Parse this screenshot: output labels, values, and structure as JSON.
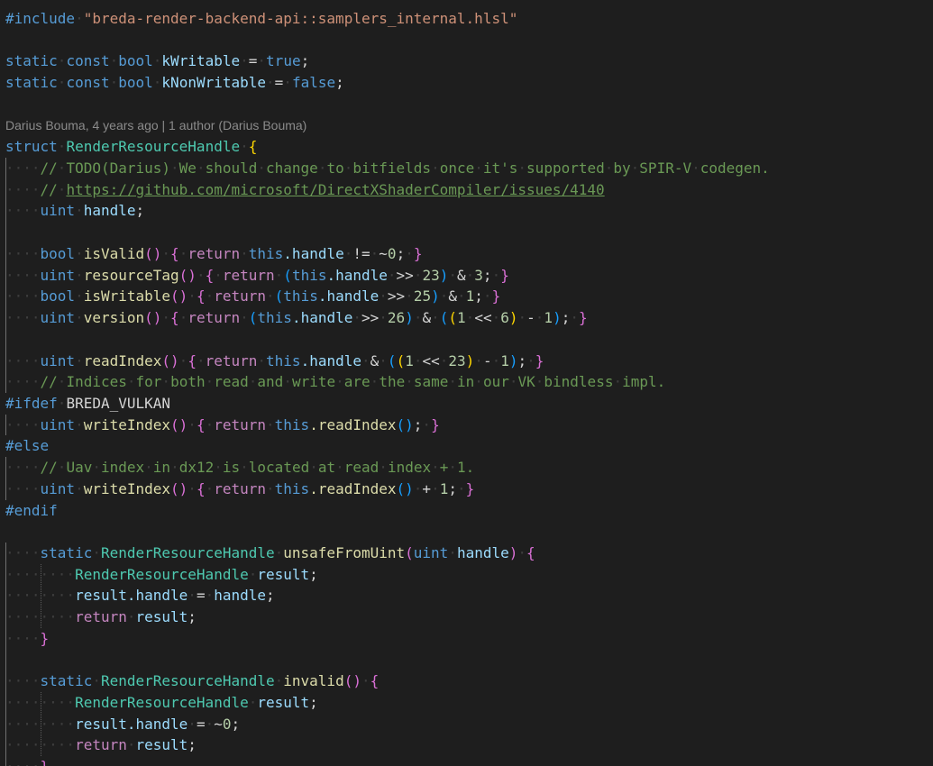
{
  "editor": {
    "language": "hlsl",
    "blame": "Darius Bouma, 4 years ago | 1 author (Darius Bouma)",
    "lines": [
      {
        "i": 0,
        "t": [
          [
            "#include ",
            "kw-dir"
          ],
          [
            "\"breda-render-backend-api::samplers_internal.hlsl\"",
            "str"
          ]
        ]
      },
      {
        "i": 0,
        "t": []
      },
      {
        "i": 0,
        "t": [
          [
            "static",
            "kw"
          ],
          [
            " const",
            "kw"
          ],
          [
            " bool",
            "kw"
          ],
          [
            " kWritable",
            "var"
          ],
          [
            " = "
          ],
          [
            "true",
            "kw"
          ],
          [
            ";"
          ]
        ]
      },
      {
        "i": 0,
        "t": [
          [
            "static",
            "kw"
          ],
          [
            " const",
            "kw"
          ],
          [
            " bool",
            "kw"
          ],
          [
            " kNonWritable",
            "var"
          ],
          [
            " = "
          ],
          [
            "false",
            "kw"
          ],
          [
            ";"
          ]
        ]
      },
      {
        "i": 0,
        "t": []
      },
      {
        "blame": true
      },
      {
        "i": 0,
        "t": [
          [
            "struct ",
            "kw"
          ],
          [
            "RenderResourceHandle",
            "ty"
          ],
          [
            " "
          ],
          [
            "{",
            "br-gold"
          ]
        ]
      },
      {
        "i": 1,
        "t": [
          [
            "// TODO(Darius) We should change to bitfields once it's supported by SPIR-V codegen.",
            "cmt"
          ]
        ]
      },
      {
        "i": 1,
        "t": [
          [
            "// ",
            "cmt"
          ],
          [
            "https://github.com/microsoft/DirectXShaderCompiler/issues/4140",
            "link"
          ]
        ]
      },
      {
        "i": 1,
        "t": [
          [
            "uint",
            "kw"
          ],
          [
            " handle",
            "var"
          ],
          [
            ";"
          ]
        ]
      },
      {
        "i": 0,
        "t": []
      },
      {
        "i": 1,
        "t": [
          [
            "bool",
            "kw"
          ],
          [
            " isValid",
            "fn"
          ],
          [
            "()",
            "br-pink"
          ],
          [
            " "
          ],
          [
            "{",
            "br-pink"
          ],
          [
            " return",
            "kw-ctrl"
          ],
          [
            " this",
            "kw"
          ],
          [
            ".handle",
            "var"
          ],
          [
            " != ~"
          ],
          [
            "0",
            "num"
          ],
          [
            ";"
          ],
          [
            " }",
            "br-pink"
          ]
        ]
      },
      {
        "i": 1,
        "t": [
          [
            "uint",
            "kw"
          ],
          [
            " resourceTag",
            "fn"
          ],
          [
            "()",
            "br-pink"
          ],
          [
            " "
          ],
          [
            "{",
            "br-pink"
          ],
          [
            " return",
            "kw-ctrl"
          ],
          [
            " "
          ],
          [
            "(",
            "br-blue"
          ],
          [
            "this",
            "kw"
          ],
          [
            ".handle",
            "var"
          ],
          [
            " >> "
          ],
          [
            "23",
            "num"
          ],
          [
            ")",
            "br-blue"
          ],
          [
            " & "
          ],
          [
            "3",
            "num"
          ],
          [
            ";"
          ],
          [
            " }",
            "br-pink"
          ]
        ]
      },
      {
        "i": 1,
        "t": [
          [
            "bool",
            "kw"
          ],
          [
            " isWritable",
            "fn"
          ],
          [
            "()",
            "br-pink"
          ],
          [
            " "
          ],
          [
            "{",
            "br-pink"
          ],
          [
            " return",
            "kw-ctrl"
          ],
          [
            " "
          ],
          [
            "(",
            "br-blue"
          ],
          [
            "this",
            "kw"
          ],
          [
            ".handle",
            "var"
          ],
          [
            " >> "
          ],
          [
            "25",
            "num"
          ],
          [
            ")",
            "br-blue"
          ],
          [
            " & "
          ],
          [
            "1",
            "num"
          ],
          [
            ";"
          ],
          [
            " }",
            "br-pink"
          ]
        ]
      },
      {
        "i": 1,
        "t": [
          [
            "uint",
            "kw"
          ],
          [
            " version",
            "fn"
          ],
          [
            "()",
            "br-pink"
          ],
          [
            " "
          ],
          [
            "{",
            "br-pink"
          ],
          [
            " return",
            "kw-ctrl"
          ],
          [
            " "
          ],
          [
            "(",
            "br-blue"
          ],
          [
            "this",
            "kw"
          ],
          [
            ".handle",
            "var"
          ],
          [
            " >> "
          ],
          [
            "26",
            "num"
          ],
          [
            ")",
            "br-blue"
          ],
          [
            " & "
          ],
          [
            "(",
            "br-blue"
          ],
          [
            "(",
            "br-gold"
          ],
          [
            "1",
            "num"
          ],
          [
            " << "
          ],
          [
            "6",
            "num"
          ],
          [
            ")",
            "br-gold"
          ],
          [
            " - "
          ],
          [
            "1",
            "num"
          ],
          [
            ")",
            "br-blue"
          ],
          [
            ";"
          ],
          [
            " }",
            "br-pink"
          ]
        ]
      },
      {
        "i": 0,
        "t": []
      },
      {
        "i": 1,
        "t": [
          [
            "uint",
            "kw"
          ],
          [
            " readIndex",
            "fn"
          ],
          [
            "()",
            "br-pink"
          ],
          [
            " "
          ],
          [
            "{",
            "br-pink"
          ],
          [
            " return",
            "kw-ctrl"
          ],
          [
            " this",
            "kw"
          ],
          [
            ".handle",
            "var"
          ],
          [
            " & "
          ],
          [
            "(",
            "br-blue"
          ],
          [
            "(",
            "br-gold"
          ],
          [
            "1",
            "num"
          ],
          [
            " << "
          ],
          [
            "23",
            "num"
          ],
          [
            ")",
            "br-gold"
          ],
          [
            " - "
          ],
          [
            "1",
            "num"
          ],
          [
            ")",
            "br-blue"
          ],
          [
            ";"
          ],
          [
            " }",
            "br-pink"
          ]
        ]
      },
      {
        "i": 1,
        "t": [
          [
            "// Indices for both read and write are the same in our VK bindless impl.",
            "cmt"
          ]
        ]
      },
      {
        "i": 0,
        "t": [
          [
            "#ifdef",
            "kw-dir"
          ],
          [
            " BREDA_VULKAN"
          ]
        ]
      },
      {
        "i": 1,
        "t": [
          [
            "uint",
            "kw"
          ],
          [
            " writeIndex",
            "fn"
          ],
          [
            "()",
            "br-pink"
          ],
          [
            " "
          ],
          [
            "{",
            "br-pink"
          ],
          [
            " return",
            "kw-ctrl"
          ],
          [
            " this",
            "kw"
          ],
          [
            ".readIndex",
            "fn"
          ],
          [
            "()",
            "br-blue"
          ],
          [
            ";"
          ],
          [
            " }",
            "br-pink"
          ]
        ]
      },
      {
        "i": 0,
        "t": [
          [
            "#else",
            "kw-dir"
          ]
        ]
      },
      {
        "i": 1,
        "t": [
          [
            "// Uav index in dx12 is located at read index + 1.",
            "cmt"
          ]
        ]
      },
      {
        "i": 1,
        "t": [
          [
            "uint",
            "kw"
          ],
          [
            " writeIndex",
            "fn"
          ],
          [
            "()",
            "br-pink"
          ],
          [
            " "
          ],
          [
            "{",
            "br-pink"
          ],
          [
            " return",
            "kw-ctrl"
          ],
          [
            " this",
            "kw"
          ],
          [
            ".readIndex",
            "fn"
          ],
          [
            "()",
            "br-blue"
          ],
          [
            " + "
          ],
          [
            "1",
            "num"
          ],
          [
            ";"
          ],
          [
            " }",
            "br-pink"
          ]
        ]
      },
      {
        "i": 0,
        "t": [
          [
            "#endif",
            "kw-dir"
          ]
        ]
      },
      {
        "i": 0,
        "t": []
      },
      {
        "i": 1,
        "t": [
          [
            "static",
            "kw"
          ],
          [
            " RenderResourceHandle",
            "ty"
          ],
          [
            " unsafeFromUint",
            "fn"
          ],
          [
            "(",
            "br-pink"
          ],
          [
            "uint",
            "kw"
          ],
          [
            " handle",
            "var"
          ],
          [
            ")",
            "br-pink"
          ],
          [
            " "
          ],
          [
            "{",
            "br-pink"
          ]
        ]
      },
      {
        "i": 2,
        "t": [
          [
            "RenderResourceHandle",
            "ty"
          ],
          [
            " result",
            "var"
          ],
          [
            ";"
          ]
        ]
      },
      {
        "i": 2,
        "t": [
          [
            "result",
            "var"
          ],
          [
            ".handle",
            "var"
          ],
          [
            " = "
          ],
          [
            "handle",
            "var"
          ],
          [
            ";"
          ]
        ]
      },
      {
        "i": 2,
        "t": [
          [
            "return",
            "kw-ctrl"
          ],
          [
            " result",
            "var"
          ],
          [
            ";"
          ]
        ]
      },
      {
        "i": 1,
        "t": [
          [
            "}",
            "br-pink"
          ]
        ]
      },
      {
        "i": 0,
        "t": []
      },
      {
        "i": 1,
        "t": [
          [
            "static",
            "kw"
          ],
          [
            " RenderResourceHandle",
            "ty"
          ],
          [
            " invalid",
            "fn"
          ],
          [
            "()",
            "br-pink"
          ],
          [
            " "
          ],
          [
            "{",
            "br-pink"
          ]
        ]
      },
      {
        "i": 2,
        "t": [
          [
            "RenderResourceHandle",
            "ty"
          ],
          [
            " result",
            "var"
          ],
          [
            ";"
          ]
        ]
      },
      {
        "i": 2,
        "t": [
          [
            "result",
            "var"
          ],
          [
            ".handle",
            "var"
          ],
          [
            " = ~"
          ],
          [
            "0",
            "num"
          ],
          [
            ";"
          ]
        ]
      },
      {
        "i": 2,
        "t": [
          [
            "return",
            "kw-ctrl"
          ],
          [
            " result",
            "var"
          ],
          [
            ";"
          ]
        ]
      },
      {
        "i": 1,
        "t": [
          [
            "}",
            "br-pink"
          ]
        ]
      }
    ]
  }
}
